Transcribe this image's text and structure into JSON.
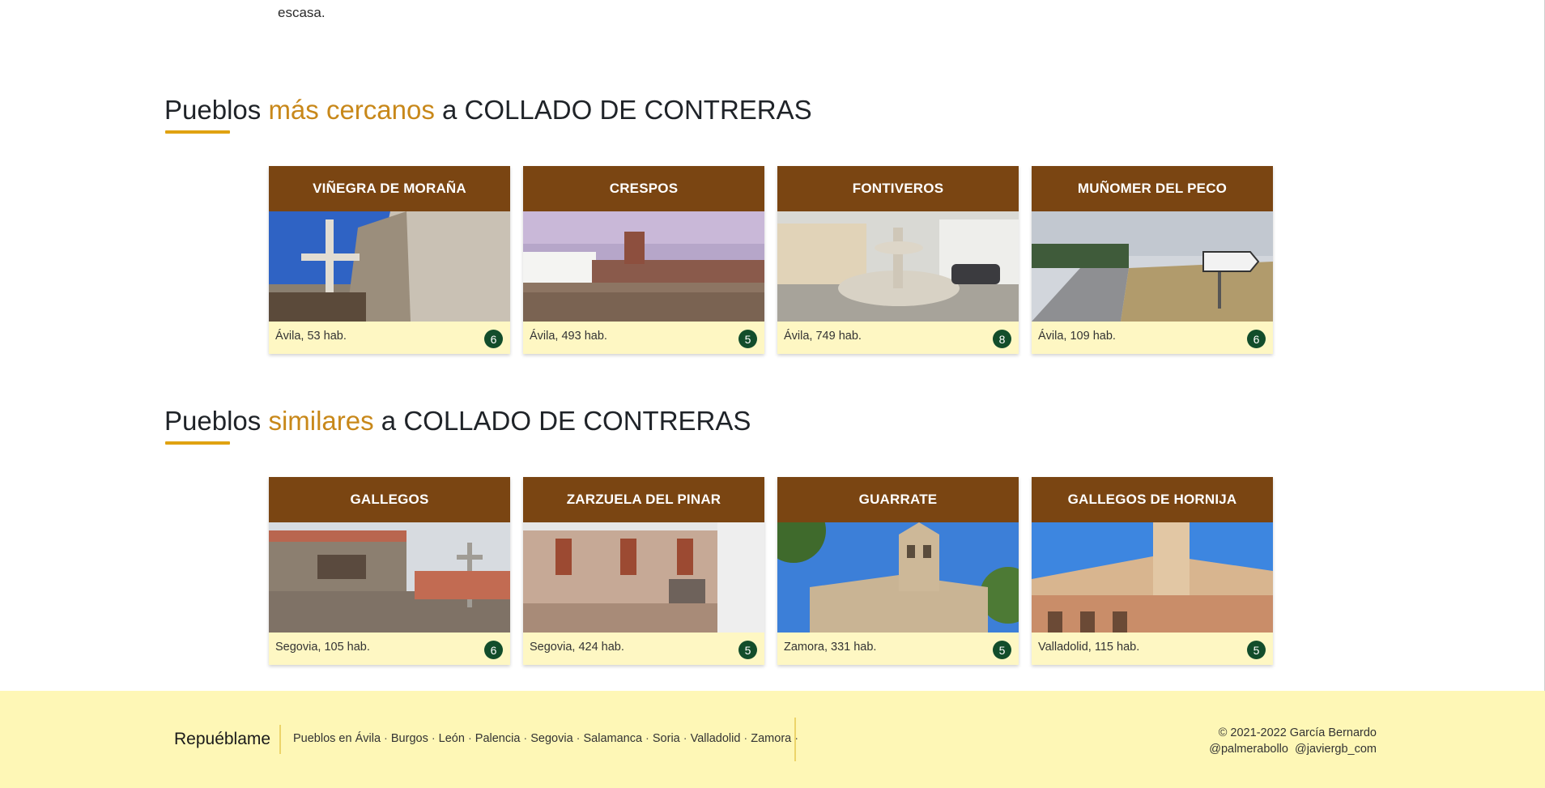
{
  "intro": {
    "text": "escasa."
  },
  "nearby": {
    "title_prefix": "Pueblos",
    "title_accent": "más cercanos",
    "title_suffix": "a COLLADO DE CONTRERAS",
    "cards": [
      {
        "name": "VIÑEGRA DE MORAÑA",
        "location": "Ávila, 53 hab.",
        "score": "6",
        "photo": "stone-cross-photo"
      },
      {
        "name": "CRESPOS",
        "location": "Ávila, 493 hab.",
        "score": "5",
        "photo": "field-church-photo"
      },
      {
        "name": "FONTIVEROS",
        "location": "Ávila, 749 hab.",
        "score": "8",
        "photo": "fountain-square-photo"
      },
      {
        "name": "MUÑOMER DEL PECO",
        "location": "Ávila, 109 hab.",
        "score": "6",
        "photo": "road-sign-photo"
      }
    ]
  },
  "similar": {
    "title_prefix": "Pueblos",
    "title_accent": "similares",
    "title_suffix": "a COLLADO DE CONTRERAS",
    "cards": [
      {
        "name": "GALLEGOS",
        "location": "Segovia, 105 hab.",
        "score": "6",
        "photo": "town-hall-photo"
      },
      {
        "name": "ZARZUELA DEL PINAR",
        "location": "Segovia, 424 hab.",
        "score": "5",
        "photo": "stone-building-photo"
      },
      {
        "name": "GUARRATE",
        "location": "Zamora, 331 hab.",
        "score": "5",
        "photo": "bell-tower-church-photo"
      },
      {
        "name": "GALLEGOS DE HORNIJA",
        "location": "Valladolid, 115 hab.",
        "score": "5",
        "photo": "brick-church-photo"
      }
    ]
  },
  "footer": {
    "brand": "Repuéblame",
    "links_prefix": "Pueblos en",
    "provinces": [
      "Ávila",
      "Burgos",
      "León",
      "Palencia",
      "Segovia",
      "Salamanca",
      "Soria",
      "Valladolid",
      "Zamora"
    ],
    "copyright": "© 2021-2022 García Bernardo",
    "handle_1": "@palmerabollo",
    "handle_2": "@javiergb_com"
  },
  "colors": {
    "accent": "#c8881a",
    "card_header": "#7a4512",
    "card_footer": "#fef7c3",
    "badge": "#124d2b",
    "footer_bg": "#fef7b6"
  }
}
